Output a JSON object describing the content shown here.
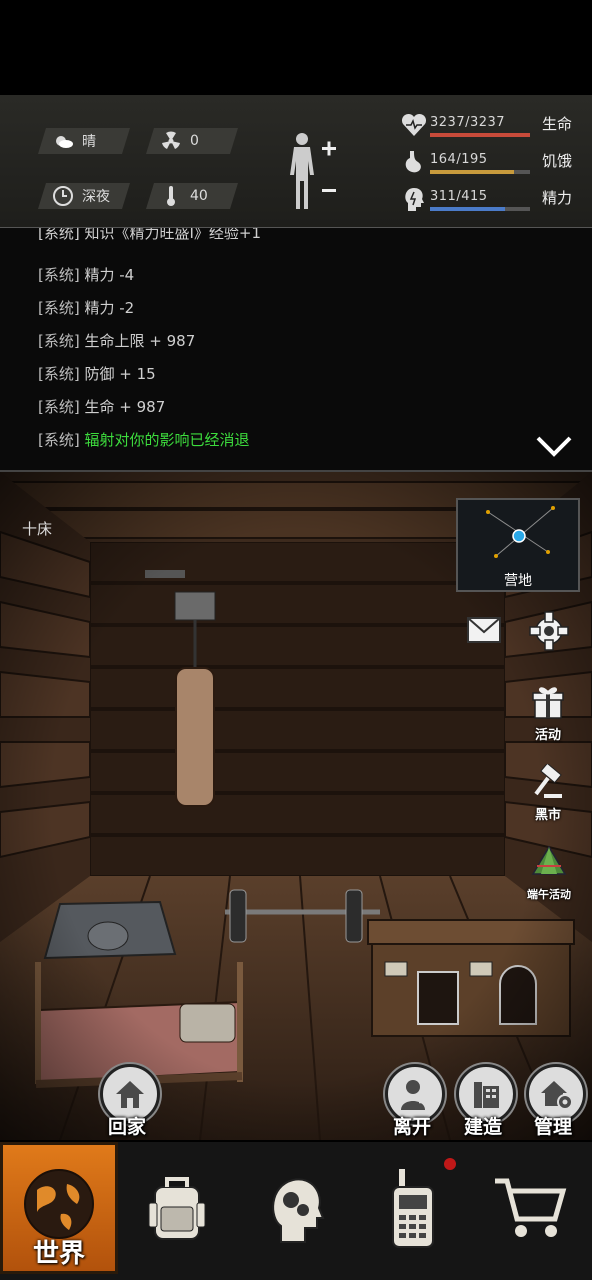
{
  "status": {
    "weather": "晴",
    "radiation": "0",
    "time_of_day": "深夜",
    "temperature": "40",
    "life": {
      "current": "3237/3237",
      "label": "生命",
      "fraction": 1.0,
      "color": "#c84b3a"
    },
    "hunger": {
      "current": "164/195",
      "label": "饥饿",
      "fraction": 0.84,
      "color": "#c79a3c"
    },
    "energy": {
      "current": "311/415",
      "label": "精力",
      "fraction": 0.75,
      "color": "#4b7bc8"
    }
  },
  "log": {
    "partial_line": "[系统] 知识《精力旺盛Ⅰ》经验+1",
    "lines": [
      {
        "tag": "[系统]",
        "msg": "精力 -4"
      },
      {
        "tag": "[系统]",
        "msg": "精力 -2"
      },
      {
        "tag": "[系统]",
        "msg": "生命上限 + 987"
      },
      {
        "tag": "[系统]",
        "msg": "防御 + 15"
      },
      {
        "tag": "[系统]",
        "msg": "生命 + 987"
      },
      {
        "tag": "[系统]",
        "msg": "辐射对你的影响已经消退"
      }
    ]
  },
  "room": {
    "location_label": "十床",
    "minimap_label": "营地",
    "side_buttons": {
      "event": "活动",
      "black_market": "黑市",
      "dragon_boat_event": "端午活动"
    },
    "actions": {
      "go_home": "回家",
      "leave": "离开",
      "build": "建造",
      "manage": "管理"
    }
  },
  "nav": {
    "world": "世界"
  }
}
